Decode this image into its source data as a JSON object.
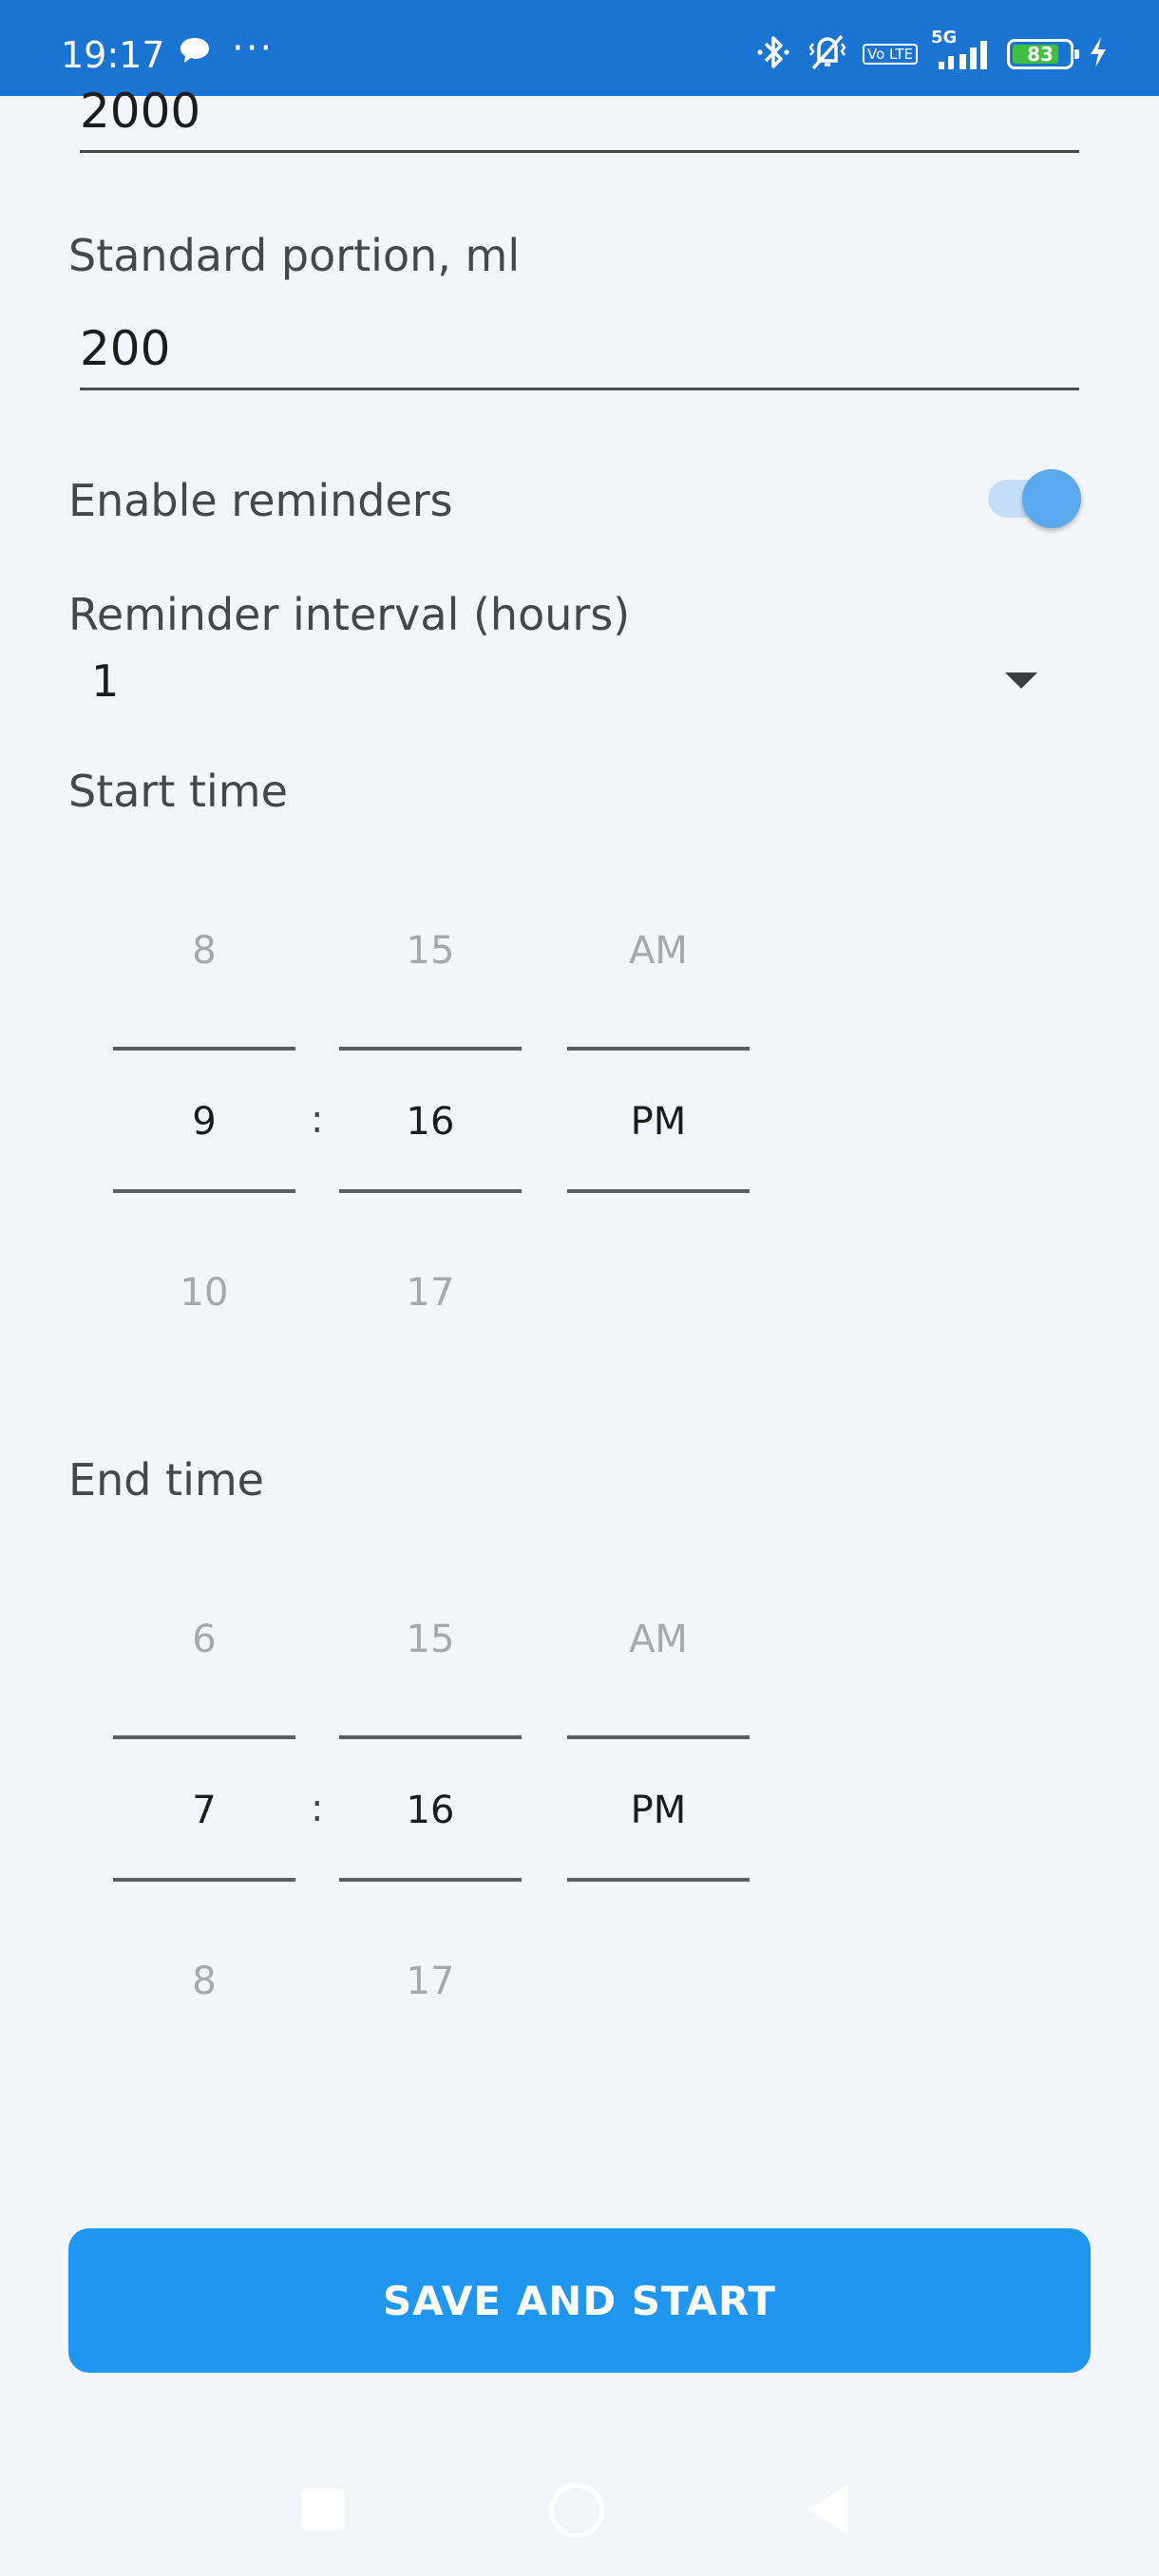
{
  "status_bar": {
    "time": "19:17",
    "dots": "···",
    "network": "5G",
    "lte": "Vo LTE",
    "battery": "83",
    "battery_level": 0.83,
    "icons": [
      "chat-bubble-icon",
      "bluetooth-icon",
      "vibrate-mute-icon",
      "volte-icon",
      "signal-icon",
      "battery-icon",
      "charging-icon"
    ]
  },
  "form": {
    "daily_goal_value": "2000",
    "portion_label": "Standard portion, ml",
    "portion_value": "200",
    "reminders_label": "Enable reminders",
    "reminders_enabled": true,
    "interval_label": "Reminder interval (hours)",
    "interval_value": "1"
  },
  "start_time": {
    "label": "Start time",
    "hour": {
      "prev": "8",
      "current": "9",
      "next": "10"
    },
    "minute": {
      "prev": "15",
      "current": "16",
      "next": "17"
    },
    "ampm": {
      "prev": "AM",
      "current": "PM"
    },
    "separator": ":"
  },
  "end_time": {
    "label": "End time",
    "hour": {
      "prev": "6",
      "current": "7",
      "next": "8"
    },
    "minute": {
      "prev": "15",
      "current": "16",
      "next": "17"
    },
    "ampm": {
      "prev": "AM",
      "current": "PM"
    },
    "separator": ":"
  },
  "actions": {
    "save_label": "SAVE AND START"
  },
  "colors": {
    "status_bar": "#1c74d2",
    "accent": "#2196f0",
    "toggle_thumb": "#5aa8ee",
    "background": "#f2f5fa"
  }
}
